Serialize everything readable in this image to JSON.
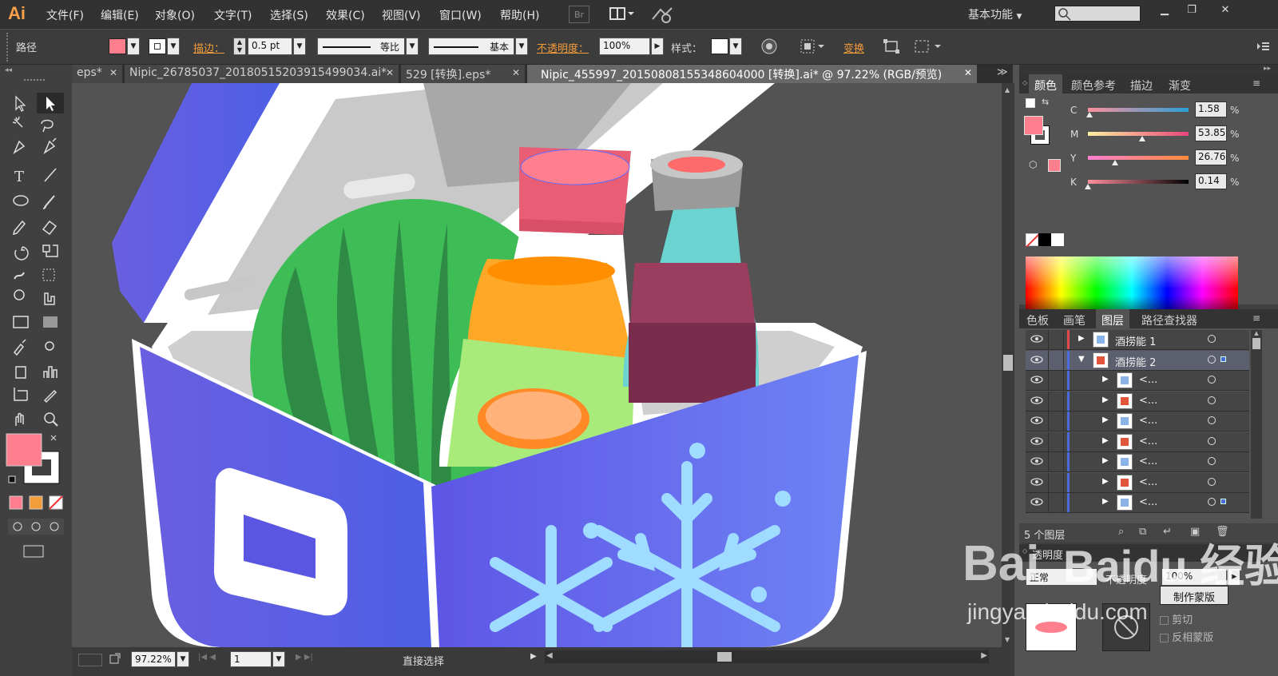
{
  "app": {
    "logo": "Ai"
  },
  "menu": [
    "文件(F)",
    "编辑(E)",
    "对象(O)",
    "文字(T)",
    "选择(S)",
    "效果(C)",
    "视图(V)",
    "窗口(W)",
    "帮助(H)"
  ],
  "bridge_label": "Br",
  "workspace": "基本功能",
  "control": {
    "object_type": "路径",
    "stroke_label": "描边：",
    "stroke_value": "0.5 pt",
    "stroke_profile": "等比",
    "brush": "基本",
    "opacity_label": "不透明度：",
    "opacity_value": "100%",
    "style_label": "样式：",
    "transform_label": "变换",
    "fill_color": "#ff7f8e"
  },
  "tabs": [
    {
      "label": "eps*"
    },
    {
      "label": "Nipic_26785037_20180515203915499034.ai*"
    },
    {
      "label": "529 [转换].eps*"
    },
    {
      "label": "Nipic_455997_20150808155348604000 [转换].ai* @ 97.22% (RGB/预览)"
    }
  ],
  "color_panel": {
    "tabs": [
      "颜色",
      "颜色参考",
      "描边",
      "渐变"
    ],
    "channels": [
      {
        "name": "C",
        "value": "1.58",
        "pct": 0.016
      },
      {
        "name": "M",
        "value": "53.85",
        "pct": 0.54
      },
      {
        "name": "Y",
        "value": "26.76",
        "pct": 0.27
      },
      {
        "name": "K",
        "value": "0.14",
        "pct": 0.001
      }
    ],
    "percent": "%"
  },
  "layers_panel": {
    "tabs": [
      "色板",
      "画笔",
      "图层",
      "路径查找器"
    ],
    "layers": [
      {
        "name": "酒捞能 1",
        "level": 0,
        "expanded": false,
        "color": "#e24b4b"
      },
      {
        "name": "酒捞能 2",
        "level": 0,
        "expanded": true,
        "color": "#4a6bd8"
      },
      {
        "name": "<...",
        "level": 1
      },
      {
        "name": "<...",
        "level": 1
      },
      {
        "name": "<...",
        "level": 1
      },
      {
        "name": "<...",
        "level": 1
      },
      {
        "name": "<...",
        "level": 1
      },
      {
        "name": "<...",
        "level": 1
      },
      {
        "name": "<...",
        "level": 1
      }
    ],
    "count": "5 个图层"
  },
  "transparency_panel": {
    "title": "透明度",
    "mode": "正常",
    "opacity_label": "不透明度",
    "opacity_value": "100%",
    "make_mask": "制作蒙版",
    "clip": "剪切",
    "invert_mask": "反相蒙版"
  },
  "status": {
    "zoom": "97.22%",
    "page": "1",
    "tool": "直接选择"
  },
  "watermark": {
    "brand": "Baidu 经验",
    "url": "jingyan.baidu.com"
  },
  "colors": {
    "accent": "#f39c3b",
    "fill": "#ff7f8e",
    "cooler": "#5b63e8"
  }
}
